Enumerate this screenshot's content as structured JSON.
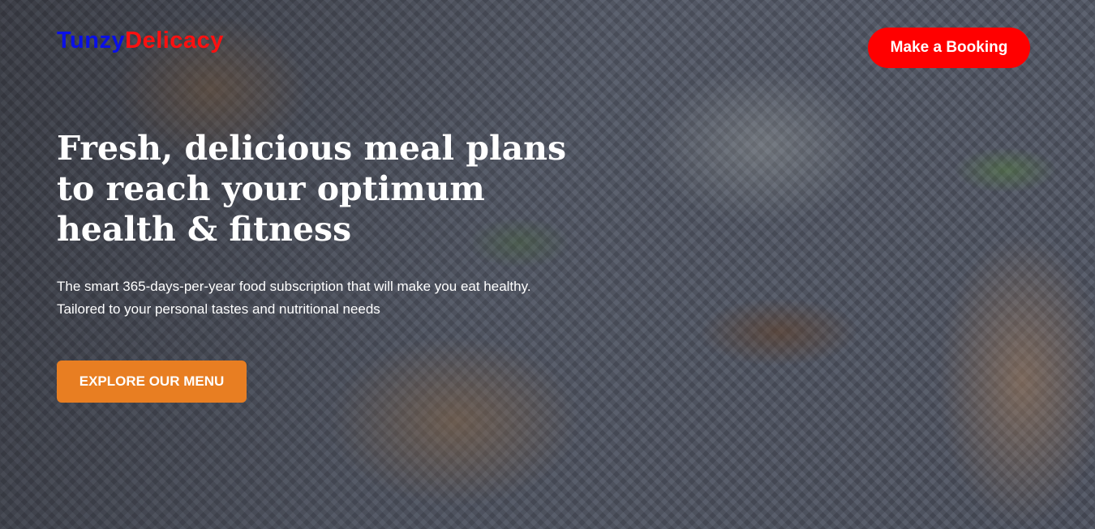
{
  "brand": {
    "part1": "Tunzy",
    "part2": "Delicacy",
    "color1": "#0a10e6",
    "color2": "#ff1010"
  },
  "header": {
    "booking_label": "Make a Booking",
    "booking_color": "#ff0000"
  },
  "hero": {
    "headline": "Fresh, delicious meal plans to reach your optimum health & fitness",
    "subtitle": "The smart 365-days-per-year food subscription that will make you eat healthy. Tailored to your personal tastes and nutritional needs",
    "cta_label": "EXPLORE OUR MENU",
    "cta_color": "#e87e22"
  }
}
